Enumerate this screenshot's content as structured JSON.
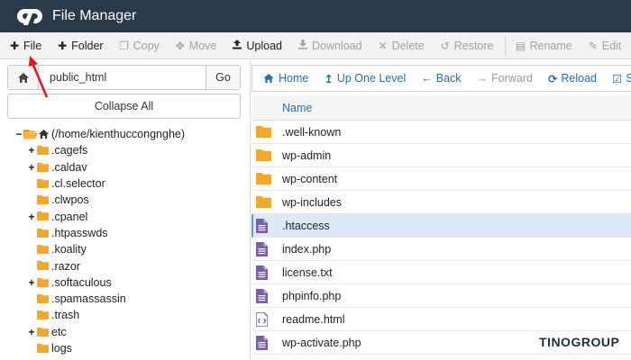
{
  "header": {
    "title": "File Manager",
    "logo_icon": "cpanel-logo-icon"
  },
  "toolbar": {
    "file": "File",
    "folder": "Folder",
    "copy": "Copy",
    "move": "Move",
    "upload": "Upload",
    "download": "Download",
    "delete": "Delete",
    "restore": "Restore",
    "rename": "Rename",
    "edit": "Edit"
  },
  "path": {
    "value": "public_html",
    "go": "Go",
    "collapse": "Collapse All"
  },
  "tree": {
    "root": "(/home/kienthuccongnghe)",
    "items": [
      ".cagefs",
      ".caldav",
      ".cl.selector",
      ".clwpos",
      ".cpanel",
      ".htpasswds",
      ".koality",
      ".razor",
      ".softaculous",
      ".spamassassin",
      ".trash",
      "etc",
      "logs"
    ]
  },
  "nav": {
    "home": "Home",
    "up": "Up One Level",
    "back": "Back",
    "forward": "Forward",
    "reload": "Reload",
    "select": "Se"
  },
  "list": {
    "name_header": "Name",
    "files": [
      ".well-known",
      "wp-admin",
      "wp-content",
      "wp-includes",
      ".htaccess",
      "index.php",
      "license.txt",
      "phpinfo.php",
      "readme.html",
      "wp-activate.php"
    ]
  },
  "brand": {
    "text_a": "TINO",
    "text_b": "GROUP"
  },
  "colors": {
    "header_bg": "#293a4a",
    "link": "#2a6db0",
    "folder": "#f0a830",
    "file": "#7a5fa6",
    "selected_bg": "#dbeaf6"
  }
}
